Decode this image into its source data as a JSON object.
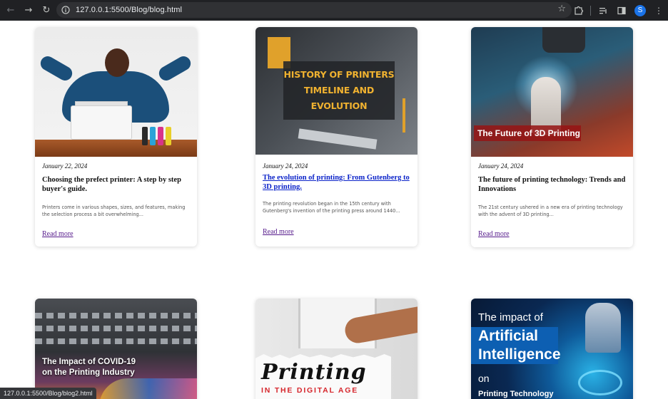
{
  "browser": {
    "url": "127.0.0.1:5500/Blog/blog.html",
    "profile_initial": "S",
    "icons": [
      "back-icon",
      "forward-icon",
      "reload-icon",
      "site-info-icon",
      "bookmark-star-icon",
      "extensions-icon",
      "media-icon",
      "side-panel-icon",
      "menu-icon"
    ]
  },
  "cards": [
    {
      "date": "January 22, 2024",
      "title": "Choosing the prefect printer: A step by step buyer's guide.",
      "excerpt": "Printers come in various shapes, sizes, and features, making the selection process a bit overwhelming...",
      "read_more": "Read more"
    },
    {
      "date": "January 24, 2024",
      "title": "The evolution of printing: From Gutenberg to 3D printing.",
      "excerpt": "The printing revolution began in the 15th century with Gutenberg's invention of the printing press around 1440...",
      "read_more": "Read more",
      "image_lines": [
        "HISTORY OF PRINTERS",
        "TIMELINE AND",
        "EVOLUTION"
      ]
    },
    {
      "date": "January 24, 2024",
      "title": "The future of printing technology: Trends and Innovations",
      "excerpt": "The 21st century ushered in a new era of printing technology with the advent of 3D printing...",
      "read_more": "Read more",
      "image_label": "The Future of 3D Printing"
    },
    {
      "image_lines": [
        "The Impact of COVID-19",
        "on the Printing Industry"
      ]
    },
    {
      "image_title": "Printing",
      "image_sub": "IN THE DIGITAL AGE"
    },
    {
      "image_lines": [
        "The impact of",
        "Artificial",
        "Intelligence",
        "on",
        "Printing Technology"
      ]
    }
  ],
  "status_bar": "127.0.0.1:5500/Blog/blog2.html",
  "colors": {
    "link_visited": "#551a8b",
    "link_active": "#0b23c9",
    "chrome_bg": "#202124"
  }
}
